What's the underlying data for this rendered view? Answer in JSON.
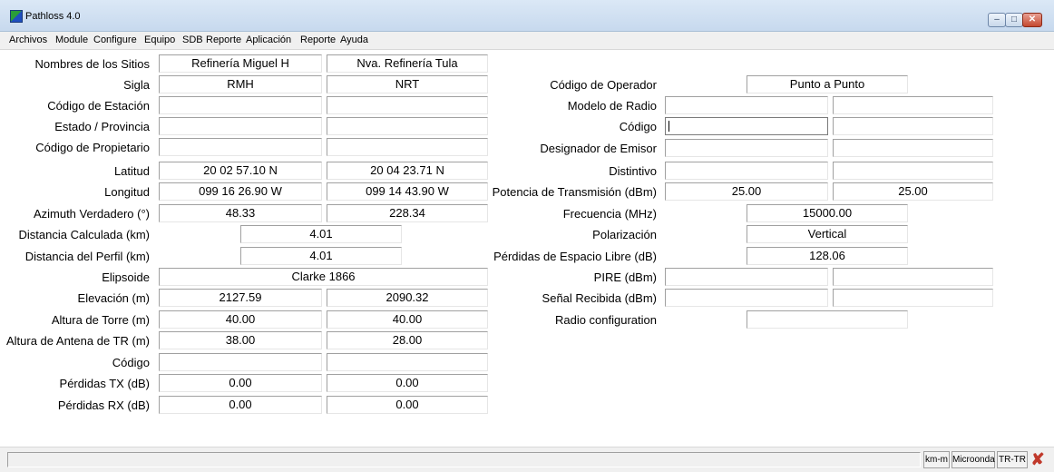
{
  "window": {
    "title": "Pathloss 4.0",
    "min": "–",
    "max": "□",
    "close": "✕"
  },
  "menu": [
    "Archivos",
    "Module",
    "Configure",
    "Equipo",
    "SDB",
    "Reporte",
    "Aplicación",
    "Reporte",
    "Ayuda"
  ],
  "left": {
    "sitios": {
      "label": "Nombres de los Sitios",
      "a": "Refinería Miguel H",
      "b": "Nva. Refinería Tula"
    },
    "sigla": {
      "label": "Sigla",
      "a": "RMH",
      "b": "NRT"
    },
    "estacion": {
      "label": "Código de Estación",
      "a": "",
      "b": ""
    },
    "estado": {
      "label": "Estado / Provincia",
      "a": "",
      "b": ""
    },
    "propietario": {
      "label": "Código de Propietario",
      "a": "",
      "b": ""
    },
    "latitud": {
      "label": "Latitud",
      "a": "20 02 57.10 N",
      "b": "20 04 23.71 N"
    },
    "longitud": {
      "label": "Longitud",
      "a": "099 16 26.90 W",
      "b": "099 14 43.90 W"
    },
    "azimuth": {
      "label": "Azimuth Verdadero (°)",
      "a": "48.33",
      "b": "228.34"
    },
    "dist_calc": {
      "label": "Distancia Calculada (km)",
      "value": "4.01"
    },
    "dist_perfil": {
      "label": "Distancia del Perfil (km)",
      "value": "4.01"
    },
    "elipsoide": {
      "label": "Elipsoide",
      "value": "Clarke 1866"
    },
    "elevacion": {
      "label": "Elevación (m)",
      "a": "2127.59",
      "b": "2090.32"
    },
    "torre": {
      "label": "Altura de Torre (m)",
      "a": "40.00",
      "b": "40.00"
    },
    "antena": {
      "label": "Altura de Antena de TR (m)",
      "a": "38.00",
      "b": "28.00"
    },
    "codigo": {
      "label": "Código",
      "a": "",
      "b": ""
    },
    "perd_tx": {
      "label": "Pérdidas TX (dB)",
      "a": "0.00",
      "b": "0.00"
    },
    "perd_rx": {
      "label": "Pérdidas RX (dB)",
      "a": "0.00",
      "b": "0.00"
    }
  },
  "right": {
    "operador": {
      "label": "Código de Operador",
      "value": "Punto a Punto"
    },
    "modelo": {
      "label": "Modelo de Radio",
      "a": "",
      "b": ""
    },
    "codigo": {
      "label": "Código",
      "a": "",
      "b": ""
    },
    "emisor": {
      "label": "Designador de Emisor",
      "a": "",
      "b": ""
    },
    "distintivo": {
      "label": "Distintivo",
      "a": "",
      "b": ""
    },
    "potencia": {
      "label": "Potencia de Transmisión (dBm)",
      "a": "25.00",
      "b": "25.00"
    },
    "frecuencia": {
      "label": "Frecuencia (MHz)",
      "value": "15000.00"
    },
    "polarizacion": {
      "label": "Polarización",
      "value": "Vertical"
    },
    "perdidas_esp": {
      "label": "Pérdidas de Espacio Libre (dB)",
      "value": "128.06"
    },
    "pire": {
      "label": "PIRE (dBm)",
      "a": "",
      "b": ""
    },
    "senal": {
      "label": "Señal Recibida (dBm)",
      "a": "",
      "b": ""
    },
    "radio_conf": {
      "label": "Radio configuration",
      "value": ""
    }
  },
  "status": {
    "units": "km-m",
    "mode": "Microonda",
    "link": "TR-TR",
    "close_icon": "✘"
  }
}
